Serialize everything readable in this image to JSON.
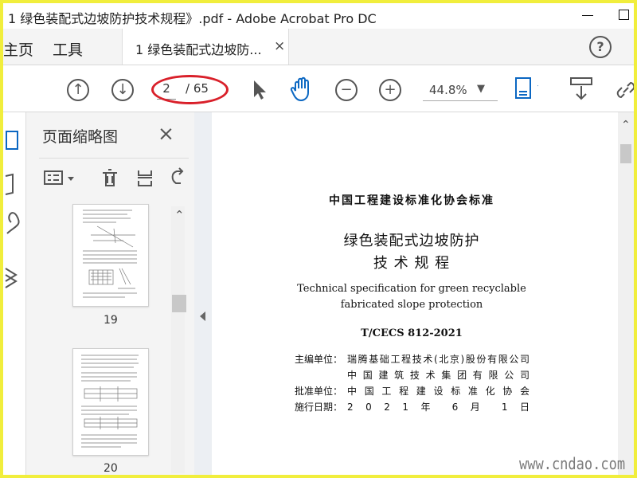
{
  "window": {
    "title": "1 绿色装配式边坡防护技术规程》.pdf - Adobe Acrobat Pro DC"
  },
  "tabs": {
    "home": "主页",
    "tools": "工具",
    "document": "1 绿色装配式边坡防...",
    "close": "×"
  },
  "toolbar": {
    "current_page": "2",
    "total_pages": "/ 65",
    "zoom": "44.8%"
  },
  "thumbnails": {
    "title": "页面缩略图",
    "close": "×",
    "items": [
      {
        "label": "19"
      },
      {
        "label": "20"
      }
    ]
  },
  "document_page": {
    "standard_header": "中国工程建设标准化协会标准",
    "cn_title_line1": "绿色装配式边坡防护",
    "cn_title_line2": "技 术 规 程",
    "en_title_line1": "Technical specification for green recyclable",
    "en_title_line2": "fabricated slope protection",
    "code": "T/CECS 812-2021",
    "info": [
      {
        "label": "主编单位：",
        "value": "瑞腾基础工程技术(北京)股份有限公司"
      },
      {
        "label": "",
        "value": "中国建筑技术集团有限公司"
      },
      {
        "label": "批准单位：",
        "value": "中国工程建设标准化协会"
      },
      {
        "label": "施行日期：",
        "value": "2 0 2 1 年 6 月 1 日"
      }
    ]
  },
  "watermark": "www.cndao.com",
  "colors": {
    "border_yellow": "#f1ee3c",
    "annotation_red": "#d9202a",
    "accent_blue": "#0b67c2"
  }
}
